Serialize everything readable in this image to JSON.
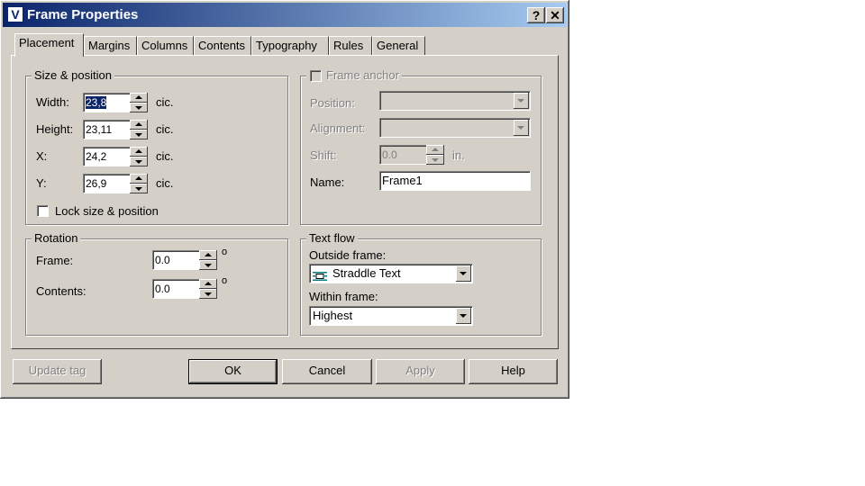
{
  "window": {
    "title": "Frame Properties",
    "app_icon_letter": "V",
    "help_glyph": "?",
    "close_glyph": "✕"
  },
  "tabs": [
    "Placement",
    "Margins",
    "Columns",
    "Contents",
    "Typography",
    "Rules",
    "General"
  ],
  "size_position": {
    "legend": "Size & position",
    "width": {
      "label": "Width:",
      "value": "23,8",
      "unit": "cic."
    },
    "height": {
      "label": "Height:",
      "value": "23,11",
      "unit": "cic."
    },
    "x": {
      "label": "X:",
      "value": "24,2",
      "unit": "cic."
    },
    "y": {
      "label": "Y:",
      "value": "26,9",
      "unit": "cic."
    },
    "lock_label": "Lock size & position"
  },
  "frame_anchor": {
    "legend": "Frame anchor",
    "position_label": "Position:",
    "alignment_label": "Alignment:",
    "shift_label": "Shift:",
    "shift_value": "0.0",
    "shift_unit": "in.",
    "name_label": "Name:",
    "name_value": "Frame1"
  },
  "rotation": {
    "legend": "Rotation",
    "frame_label": "Frame:",
    "frame_value": "0.0",
    "contents_label": "Contents:",
    "contents_value": "0.0",
    "degree": "o"
  },
  "text_flow": {
    "legend": "Text flow",
    "outside_label": "Outside frame:",
    "outside_value": "Straddle Text",
    "within_label": "Within frame:",
    "within_value": "Highest"
  },
  "buttons": {
    "update_tag": "Update tag",
    "ok": "OK",
    "cancel": "Cancel",
    "apply": "Apply",
    "help": "Help"
  },
  "colors": {
    "titlebar_start": "#0a246a",
    "titlebar_end": "#a6caf0",
    "face": "#d4d0c8"
  }
}
